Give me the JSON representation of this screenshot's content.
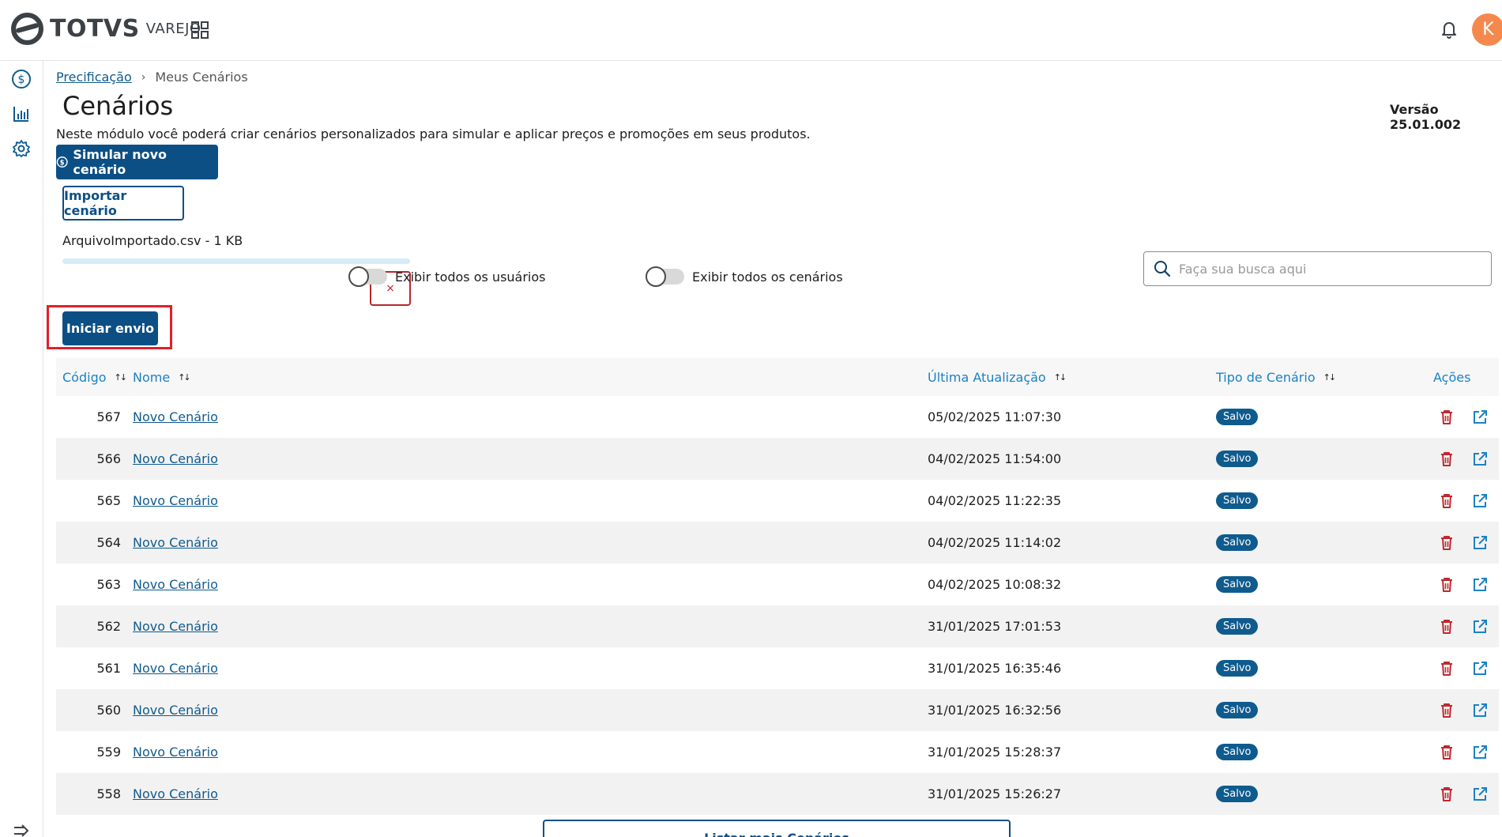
{
  "header": {
    "brand": "TOTVS",
    "brand_sub": "VAREJO",
    "avatar_initial": "K"
  },
  "breadcrumb": {
    "root": "Precificação",
    "current": "Meus Cenários"
  },
  "page": {
    "title": "Cenários",
    "version": "Versão 25.01.002",
    "description": "Neste módulo você poderá criar cenários personalizados para simular e aplicar preços e promoções em seus produtos."
  },
  "actions": {
    "new_scenario": "Simular novo cenário",
    "import_scenario": "Importar cenário",
    "start_upload": "Iniciar envio",
    "list_more": "Listar mais Cenários"
  },
  "upload": {
    "file_label": "ArquivoImportado.csv - 1 KB",
    "progress": 1.0,
    "cancel_symbol": "×"
  },
  "filters": {
    "show_all_users": "Exibir todos os usuários",
    "show_all_scenarios": "Exibir todos os cenários",
    "search_placeholder": "Faça sua busca aqui"
  },
  "table": {
    "headers": {
      "code": "Código",
      "name": "Nome",
      "updated": "Última Atualização",
      "type": "Tipo de Cenário",
      "actions": "Ações"
    },
    "rows": [
      {
        "code": "567",
        "name": "Novo Cenário",
        "updated": "05/02/2025 11:07:30",
        "type": "Salvo"
      },
      {
        "code": "566",
        "name": "Novo Cenário",
        "updated": "04/02/2025 11:54:00",
        "type": "Salvo"
      },
      {
        "code": "565",
        "name": "Novo Cenário",
        "updated": "04/02/2025 11:22:35",
        "type": "Salvo"
      },
      {
        "code": "564",
        "name": "Novo Cenário",
        "updated": "04/02/2025 11:14:02",
        "type": "Salvo"
      },
      {
        "code": "563",
        "name": "Novo Cenário",
        "updated": "04/02/2025 10:08:32",
        "type": "Salvo"
      },
      {
        "code": "562",
        "name": "Novo Cenário",
        "updated": "31/01/2025 17:01:53",
        "type": "Salvo"
      },
      {
        "code": "561",
        "name": "Novo Cenário",
        "updated": "31/01/2025 16:35:46",
        "type": "Salvo"
      },
      {
        "code": "560",
        "name": "Novo Cenário",
        "updated": "31/01/2025 16:32:56",
        "type": "Salvo"
      },
      {
        "code": "559",
        "name": "Novo Cenário",
        "updated": "31/01/2025 15:28:37",
        "type": "Salvo"
      },
      {
        "code": "558",
        "name": "Novo Cenário",
        "updated": "31/01/2025 15:26:27",
        "type": "Salvo"
      }
    ]
  },
  "colors": {
    "primary": "#0c4f85",
    "link": "#0f5b8e",
    "header_text": "#1b82c4",
    "danger": "#b5272d",
    "avatar": "#f5894d"
  },
  "icons": {
    "sidebar": [
      "dollar-circle-icon",
      "bar-chart-icon",
      "gear-icon"
    ],
    "row_actions": [
      "trash-icon",
      "external-link-icon"
    ]
  }
}
